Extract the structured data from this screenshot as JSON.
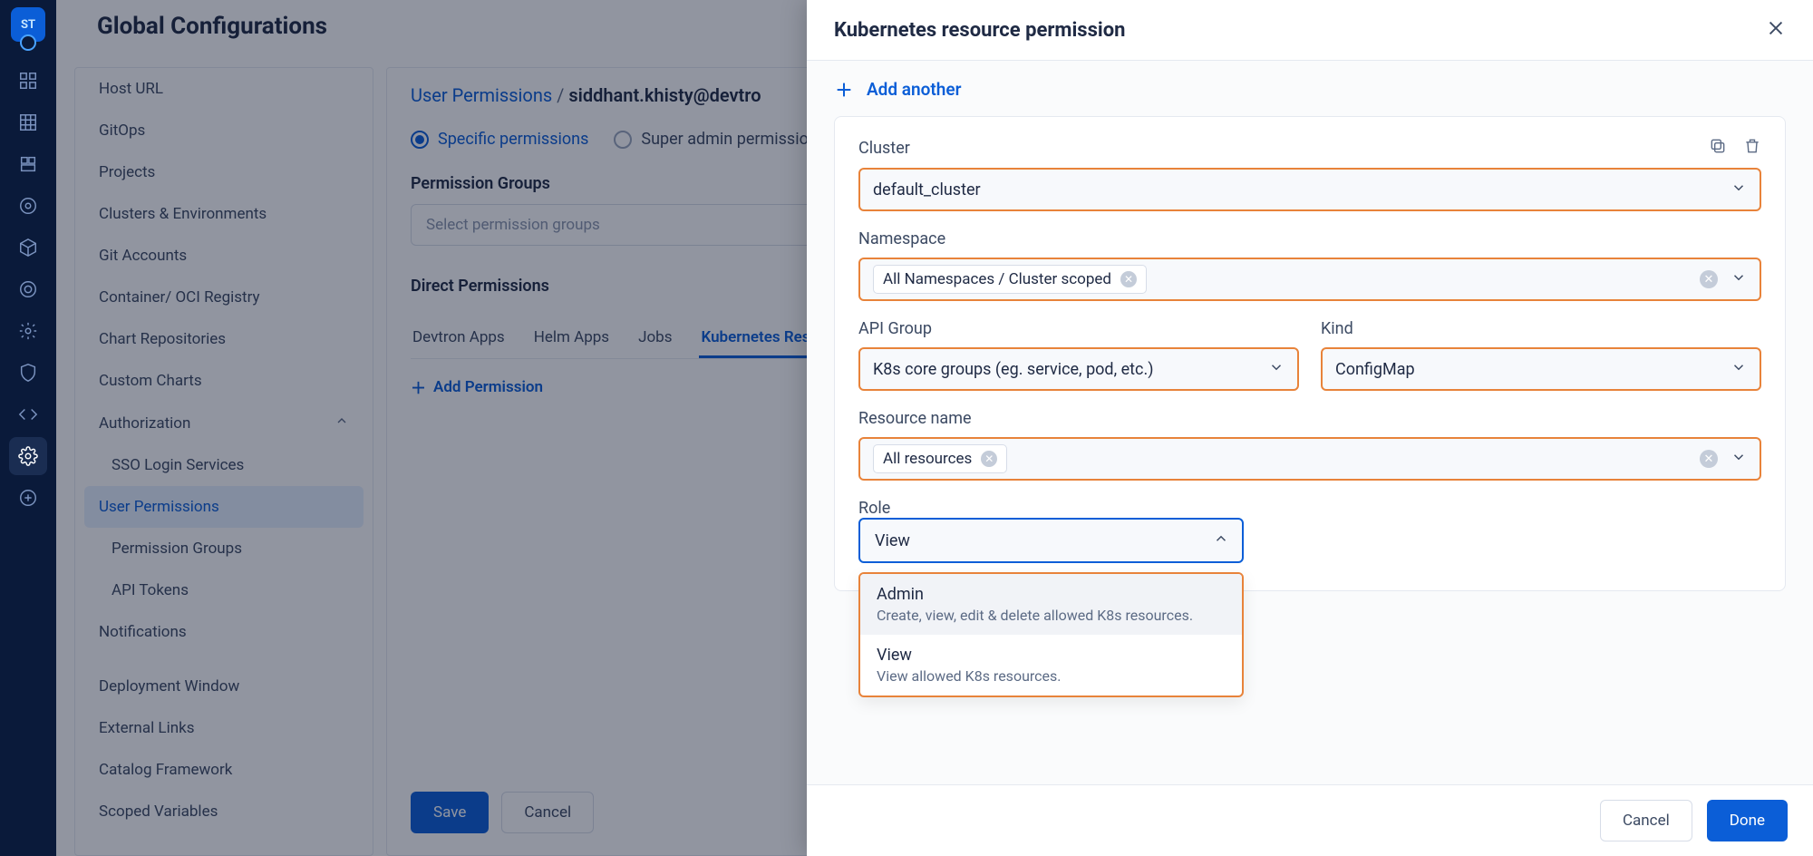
{
  "rail": {
    "logo": "ST"
  },
  "page_title": "Global Configurations",
  "sidenav": {
    "items": [
      "Host URL",
      "GitOps",
      "Projects",
      "Clusters & Environments",
      "Git Accounts",
      "Container/ OCI Registry",
      "Chart Repositories",
      "Custom Charts"
    ],
    "auth_label": "Authorization",
    "auth_children": [
      "SSO Login Services",
      "User Permissions",
      "Permission Groups",
      "API Tokens"
    ],
    "after": [
      "Notifications",
      "Deployment Window",
      "External Links",
      "Catalog Framework",
      "Scoped Variables"
    ]
  },
  "main": {
    "breadcrumb_root": "User Permissions",
    "breadcrumb_sep": " / ",
    "breadcrumb_current": "siddhant.khisty@devtro",
    "radio_specific": "Specific permissions",
    "radio_super": "Super admin permissions",
    "perm_groups_label": "Permission Groups",
    "perm_groups_placeholder": "Select permission groups",
    "direct_perms_label": "Direct Permissions",
    "tabs": [
      "Devtron Apps",
      "Helm Apps",
      "Jobs",
      "Kubernetes Resources"
    ],
    "add_permission": "Add Permission",
    "save": "Save",
    "cancel": "Cancel"
  },
  "drawer": {
    "title": "Kubernetes resource permission",
    "add_another": "Add another",
    "cluster_label": "Cluster",
    "cluster_value": "default_cluster",
    "namespace_label": "Namespace",
    "namespace_chip": "All Namespaces / Cluster scoped",
    "apigroup_label": "API Group",
    "apigroup_value": "K8s core groups (eg. service, pod, etc.)",
    "kind_label": "Kind",
    "kind_value": "ConfigMap",
    "resource_label": "Resource name",
    "resource_chip": "All resources",
    "role_label": "Role",
    "role_value": "View",
    "role_options": [
      {
        "title": "Admin",
        "desc": "Create, view, edit & delete allowed K8s resources."
      },
      {
        "title": "View",
        "desc": "View allowed K8s resources."
      }
    ],
    "cancel": "Cancel",
    "done": "Done"
  }
}
